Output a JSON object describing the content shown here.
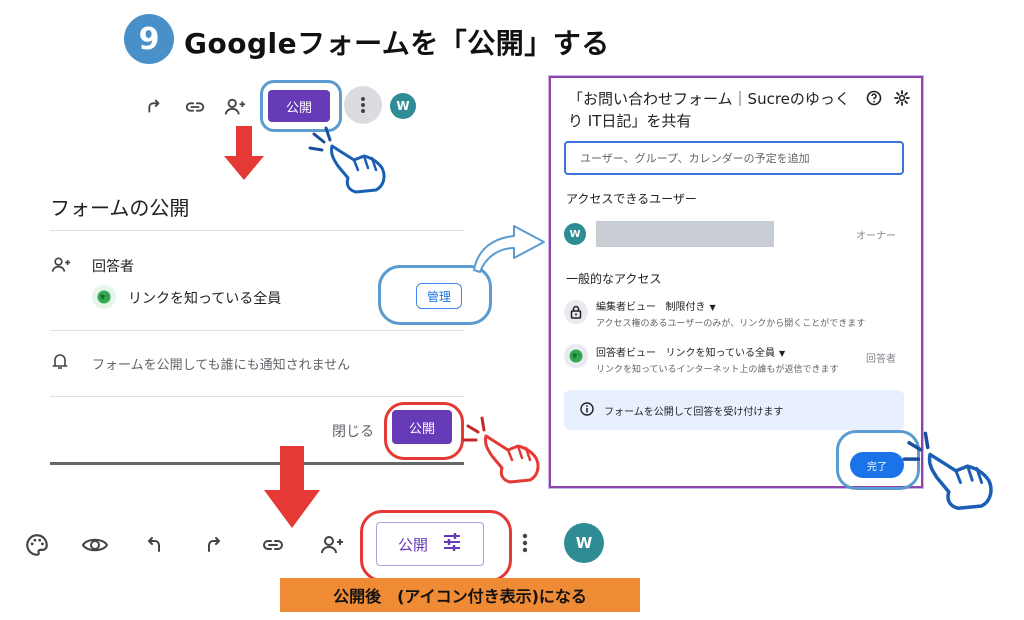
{
  "header": {
    "step_number": "9",
    "title": "Googleフォームを「公開」する"
  },
  "top_toolbar": {
    "publish_label": "公開",
    "avatar_letter": "W",
    "icons": [
      "redo-icon",
      "link-icon",
      "add-person-icon",
      "more-vert-icon"
    ]
  },
  "publish_panel": {
    "title": "フォームの公開",
    "responders_label": "回答者",
    "link_access_label": "リンクを知っている全員",
    "manage_label": "管理",
    "notify_text": "フォームを公開しても誰にも通知されません",
    "close_label": "閉じる",
    "publish_label": "公開"
  },
  "bottom_toolbar": {
    "publish_label": "公開",
    "avatar_letter": "W",
    "icons": [
      "palette-icon",
      "eye-icon",
      "undo-icon",
      "redo-icon",
      "link-icon",
      "add-person-icon",
      "tune-icon",
      "more-vert-icon"
    ]
  },
  "caption": "公開後　(アイコン付き表示)になる",
  "share_dialog": {
    "title": "「お問い合わせフォーム｜Sucreのゆっくり IT日記」を共有",
    "input_placeholder": "ユーザー、グループ、カレンダーの予定を追加",
    "access_users_label": "アクセスできるユーザー",
    "user_avatar_letter": "W",
    "owner_label": "オーナー",
    "general_access_label": "一般的なアクセス",
    "editor_view_label": "編集者ビュー",
    "editor_restriction": "制限付き",
    "editor_desc": "アクセス権のあるユーザーのみが、リンクから開くことができます",
    "responder_view_label": "回答者ビュー",
    "responder_access": "リンクを知っている全員",
    "responder_desc": "リンクを知っているインターネット上の誰もが返信できます",
    "responder_role": "回答者",
    "info_text": "フォームを公開して回答を受け付けます",
    "done_label": "完了"
  },
  "colors": {
    "publish_purple": "#673ab7",
    "highlight_blue": "#5b9bd0",
    "highlight_red": "#e53935",
    "caption_orange": "#f08b35",
    "avatar_teal": "#2f8c95",
    "primary_blue": "#1a73e8"
  }
}
